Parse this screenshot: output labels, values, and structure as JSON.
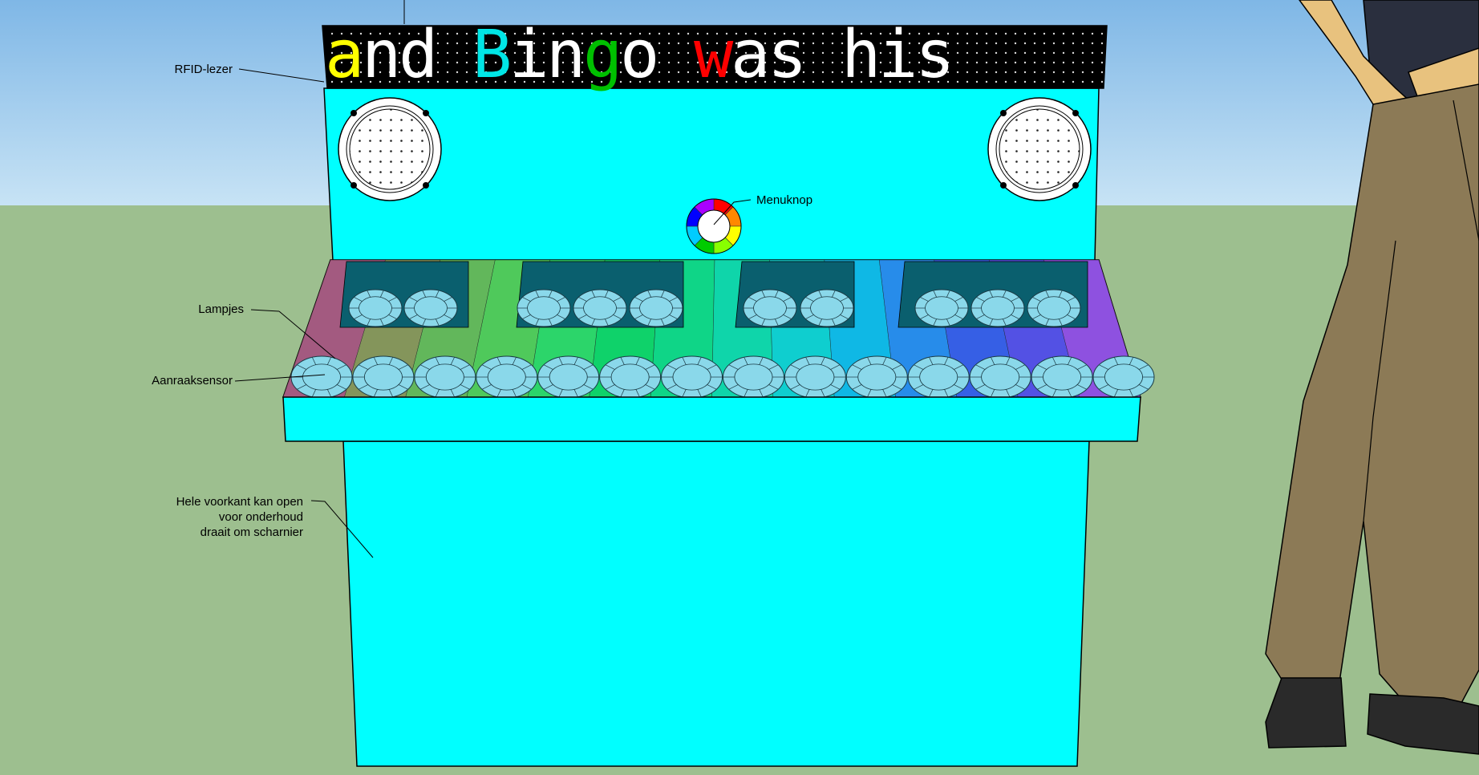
{
  "marquee": {
    "words": [
      "and",
      "Bingo",
      "was",
      "his"
    ],
    "letters": [
      {
        "char": "a",
        "color": "#ffff00"
      },
      {
        "char": "n",
        "color": "#ffffff"
      },
      {
        "char": "d",
        "color": "#ffffff"
      },
      {
        "char": " ",
        "color": "#ffffff"
      },
      {
        "char": "B",
        "color": "#00e5e5"
      },
      {
        "char": "i",
        "color": "#ffffff"
      },
      {
        "char": "n",
        "color": "#ffffff"
      },
      {
        "char": "g",
        "color": "#00c000"
      },
      {
        "char": "o",
        "color": "#ffffff"
      },
      {
        "char": " ",
        "color": "#ffffff"
      },
      {
        "char": "w",
        "color": "#ff0000"
      },
      {
        "char": "a",
        "color": "#ffffff"
      },
      {
        "char": "s",
        "color": "#ffffff"
      },
      {
        "char": " ",
        "color": "#ffffff"
      },
      {
        "char": "h",
        "color": "#ffffff"
      },
      {
        "char": "i",
        "color": "#ffffff"
      },
      {
        "char": "s",
        "color": "#ffffff"
      }
    ]
  },
  "labels": {
    "rfid": "RFID-lezer",
    "menu": "Menuknop",
    "lamps": "Lampjes",
    "touch": "Aanraaksensor",
    "front_line1": "Hele voorkant kan open",
    "front_line2": "voor onderhoud",
    "front_line3": "draait om scharnier"
  },
  "colors": {
    "sky": "#a9d3ef",
    "ground": "#9dbf8f",
    "cabinet": "#00ffff",
    "marquee_bg": "#000000",
    "button_fill": "#8ad8ea",
    "pants": "#8c7a56",
    "shirt": "#2a2f3e",
    "skin": "#e8c27e",
    "shoe": "#2a2a2a"
  },
  "keys": {
    "front_row_count": 14,
    "back_row_count": 10,
    "strip_colors": [
      "#b05a82",
      "#8f9a5a",
      "#6abf5a",
      "#55d35a",
      "#2fe06a",
      "#10dc6a",
      "#10e08a",
      "#10e0b0",
      "#10d8d8",
      "#10c0f0",
      "#2a90f5",
      "#3a60f0",
      "#5a50ee",
      "#9a50ea"
    ]
  },
  "menu_wheel_colors": [
    "#ff0000",
    "#ff8800",
    "#ffff00",
    "#88ff00",
    "#00cc00",
    "#00ccff",
    "#0000ff",
    "#aa00ff"
  ]
}
